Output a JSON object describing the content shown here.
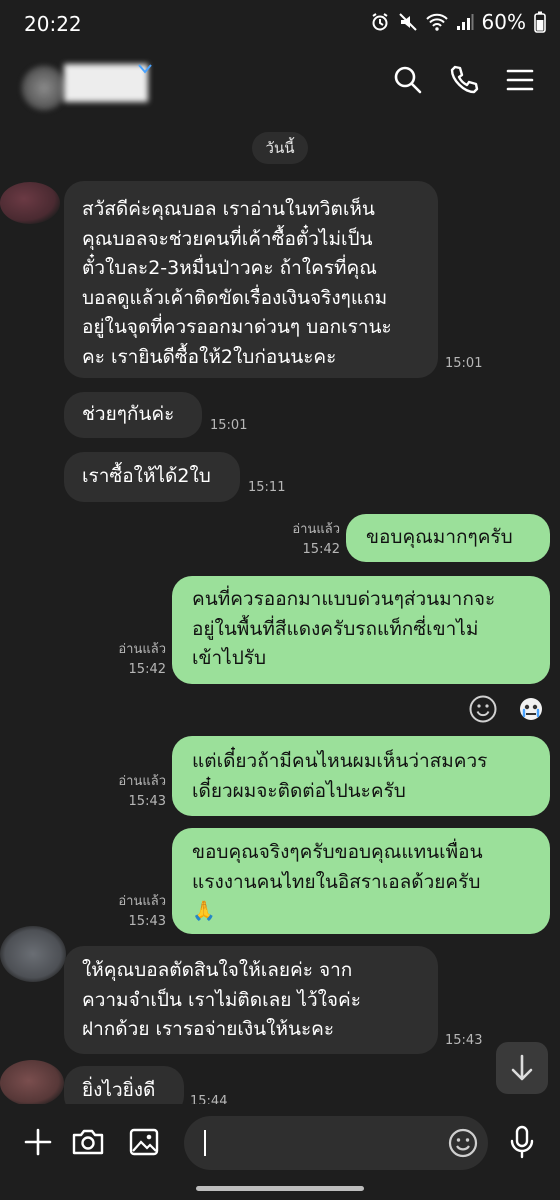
{
  "status_bar": {
    "time": "20:22",
    "battery": "60%"
  },
  "chat": {
    "date_divider": "วันนี้",
    "messages": [
      {
        "side": "in",
        "text": "สวัสดีค่ะคุณบอล เราอ่านในทวิตเห็นคุณบอลจะช่วยคนที่เค้าซื้อตั๋วไม่เป็นตั๋วใบละ2-3หมื่นป่าวคะ ถ้าใครที่คุณบอลดูแล้วเค้าติดขัดเรื่องเงินจริงๆแถมอยู่ในจุดที่ควรออกมาด่วนๆ บอกเรานะคะ เรายินดีซื้อให้2ใบก่อนนะคะ",
        "time": "15:01"
      },
      {
        "side": "in",
        "text": "ช่วยๆกันค่ะ",
        "time": "15:01"
      },
      {
        "side": "in",
        "text": "เราซื้อให้ได้2ใบ",
        "time": "15:11"
      },
      {
        "side": "out",
        "text": "ขอบคุณมากๆครับ",
        "read": "อ่านแล้ว",
        "time": "15:42"
      },
      {
        "side": "out",
        "text": "คนที่ควรออกมาแบบด่วนๆส่วนมากจะอยู่ในพื้นที่สีแดงครับรถแท็กซี่เขาไม่เข้าไปรับ",
        "read": "อ่านแล้ว",
        "time": "15:42"
      },
      {
        "side": "out",
        "text": "แต่เดี๋ยวถ้ามีคนไหนผมเห็นว่าสมควรเดี๋ยวผมจะติดต่อไปนะครับ",
        "read": "อ่านแล้ว",
        "time": "15:43"
      },
      {
        "side": "out",
        "text": "ขอบคุณจริงๆครับขอบคุณแทนเพื่อนแรงงานคนไทยในอิสราเอลด้วยครับ 🙏",
        "read": "อ่านแล้ว",
        "time": "15:43"
      },
      {
        "side": "in",
        "text": "ให้คุณบอลตัดสินใจให้เลยค่ะ จากความจำเป็น เราไม่ติดเลย ไว้ใจค่ะ ฝากด้วย เรารอจ่ายเงินให้นะคะ",
        "time": "15:43"
      },
      {
        "side": "in",
        "text": "ยิ่งไวยิ่งดี",
        "time": "15:44"
      }
    ],
    "lines": {
      "m1": [
        "สวัสดีค่ะคุณบอล เราอ่านในทวิตเห็น",
        "คุณบอลจะช่วยคนที่เค้าซื้อตั๋วไม่เป็น",
        "ตั๋วใบละ2-3หมื่นป่าวคะ ถ้าใครที่คุณ",
        "บอลดูแล้วเค้าติดขัดเรื่องเงินจริงๆแถม",
        "อยู่ในจุดที่ควรออกมาด่วนๆ บอกเรานะ",
        "คะ เรายินดีซื้อให้2ใบก่อนนะคะ"
      ],
      "m5": [
        "คนที่ควรออกมาแบบด่วนๆส่วนมากจะ",
        "อยู่ในพื้นที่สีแดงครับรถแท็กซี่เขาไม่",
        "เข้าไปรับ"
      ],
      "m6": [
        "แต่เดี๋ยวถ้ามีคนไหนผมเห็นว่าสมควร",
        "เดี๋ยวผมจะติดต่อไปนะครับ"
      ],
      "m7": [
        "ขอบคุณจริงๆครับขอบคุณแทนเพื่อน",
        "แรงงานคนไทยในอิสราเอลด้วยครับ",
        "🙏"
      ],
      "m8": [
        "ให้คุณบอลตัดสินใจให้เลยค่ะ จาก",
        "ความจำเป็น เราไม่ติดเลย ไว้ใจค่ะ",
        "ฝากด้วย เรารอจ่ายเงินให้นะคะ"
      ]
    }
  },
  "icons": {
    "header": [
      "search-icon",
      "phone-icon",
      "menu-icon"
    ],
    "reactions": [
      "smiley-icon",
      "reaction-emoji-icon"
    ],
    "input_bar": [
      "plus-icon",
      "camera-icon",
      "image-icon",
      "emoji-icon",
      "microphone-icon"
    ],
    "scroll": "arrow-down-icon"
  },
  "colors": {
    "background": "#1e1e1e",
    "incoming_bubble": "#2f2f2f",
    "outgoing_bubble": "#9be09a"
  }
}
